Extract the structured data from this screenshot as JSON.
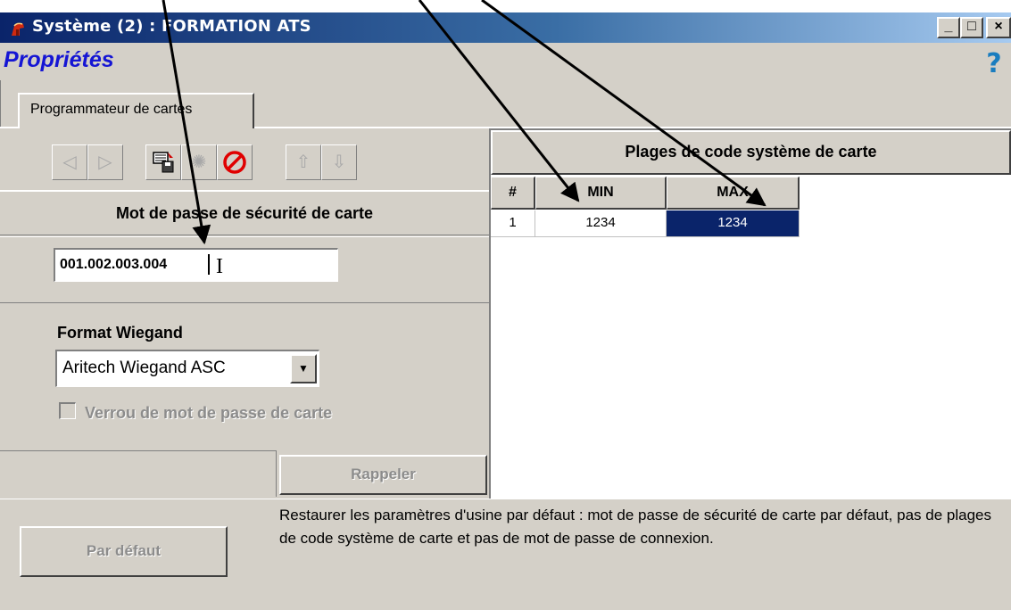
{
  "window": {
    "title": "Système (2) : FORMATION ATS",
    "controls": {
      "minimize": "_",
      "maximize": "□",
      "close": "×"
    }
  },
  "header": {
    "title": "Propriétés",
    "help_glyph": "?"
  },
  "tabs": [
    {
      "label": "Programmateur de cartes",
      "selected": true
    }
  ],
  "toolbar": {
    "buttons": [
      {
        "name": "previous",
        "icon": "arrow-left-icon",
        "glyph": "◁",
        "enabled": false
      },
      {
        "name": "next",
        "icon": "arrow-right-icon",
        "glyph": "▷",
        "enabled": false
      },
      {
        "name": "save-to-card",
        "icon": "card-save-icon",
        "glyph": "▤",
        "enabled": true
      },
      {
        "name": "reset",
        "icon": "burst-icon",
        "glyph": "✺",
        "enabled": false
      },
      {
        "name": "cancel",
        "icon": "prohibited-icon",
        "glyph": "⊘",
        "enabled": true
      },
      {
        "name": "up",
        "icon": "arrow-up-icon",
        "glyph": "⇧",
        "enabled": false
      },
      {
        "name": "down",
        "icon": "arrow-down-icon",
        "glyph": "⇩",
        "enabled": false
      }
    ]
  },
  "password_section": {
    "heading": "Mot de passe de sécurité de carte",
    "value": "001.002.003.004",
    "cursor_glyph": "I"
  },
  "wiegand": {
    "label": "Format Wiegand",
    "selected": "Aritech Wiegand ASC",
    "dropdown_glyph": "▼"
  },
  "lock_checkbox": {
    "label": "Verrou de mot de passe de carte",
    "checked": false,
    "enabled": false
  },
  "recall_button": "Rappeler",
  "ranges": {
    "heading": "Plages de code système de carte",
    "columns": [
      "#",
      "MIN",
      "MAX"
    ],
    "rows": [
      {
        "index": "1",
        "min": "1234",
        "max": "1234",
        "selected_column": "max"
      }
    ]
  },
  "bottom": {
    "default_button": "Par défaut",
    "description": "Restaurer les paramètres d'usine par défaut : mot de passe de sécurité de carte par défaut, pas de plages de code système de carte et pas de mot de passe de connexion."
  },
  "colors": {
    "title_gradient_start": "#0a246a",
    "title_gradient_end": "#a6caf0",
    "header_text": "#1515d4",
    "help_icon": "#1a7dbf",
    "selection": "#0a246a",
    "face": "#d4d0c8",
    "disabled_text": "#8c8c8c",
    "prohibited_icon": "#e00000"
  }
}
